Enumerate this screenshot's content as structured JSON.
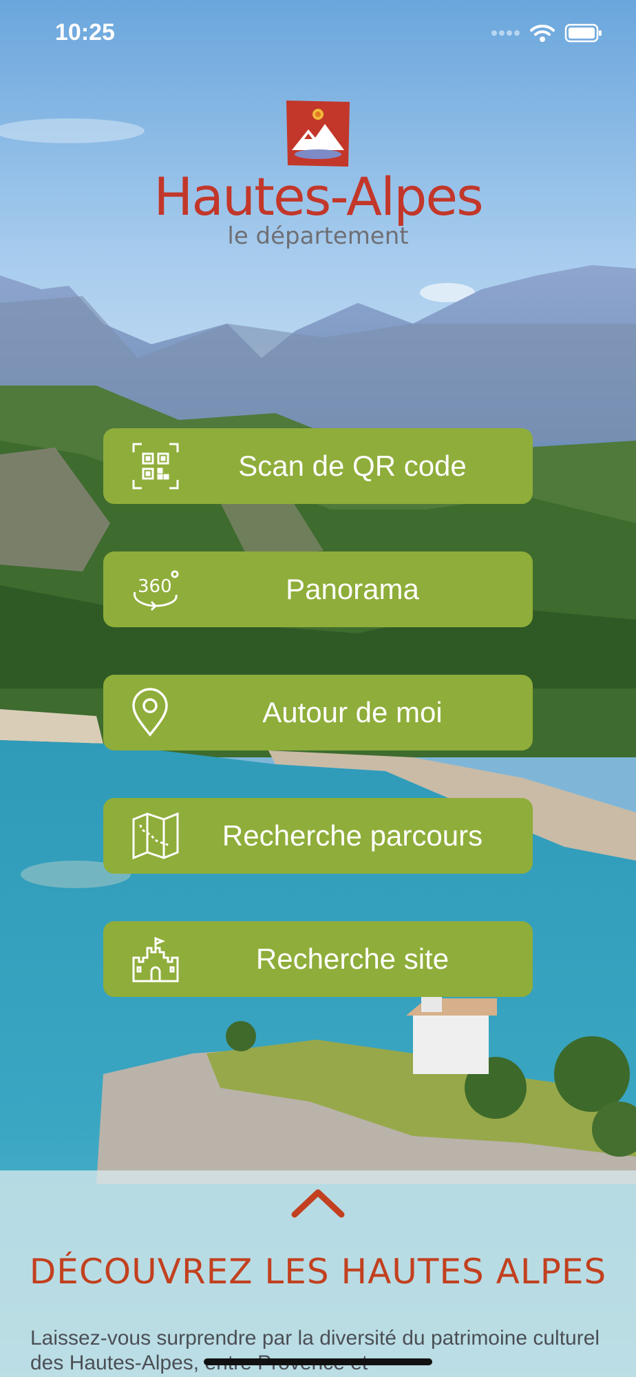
{
  "status_bar": {
    "time": "10:25"
  },
  "brand": {
    "title": "Hautes-Alpes",
    "subtitle": "le département"
  },
  "menu": {
    "items": [
      {
        "label": "Scan de QR code",
        "icon": "qr-code-icon"
      },
      {
        "label": "Panorama",
        "icon": "360-view-icon"
      },
      {
        "label": "Autour de moi",
        "icon": "location-pin-icon"
      },
      {
        "label": "Recherche parcours",
        "icon": "map-route-icon"
      },
      {
        "label": "Recherche site",
        "icon": "castle-icon"
      }
    ]
  },
  "panel": {
    "title": "DÉCOUVREZ LES HAUTES ALPES",
    "text": "Laissez-vous surprendre par la diversité du patrimoine culturel des Hautes-Alpes, entre Provence et"
  },
  "colors": {
    "button_green": "#8fad3a",
    "brand_red": "#c2372a",
    "title_orange": "#c2401f"
  }
}
